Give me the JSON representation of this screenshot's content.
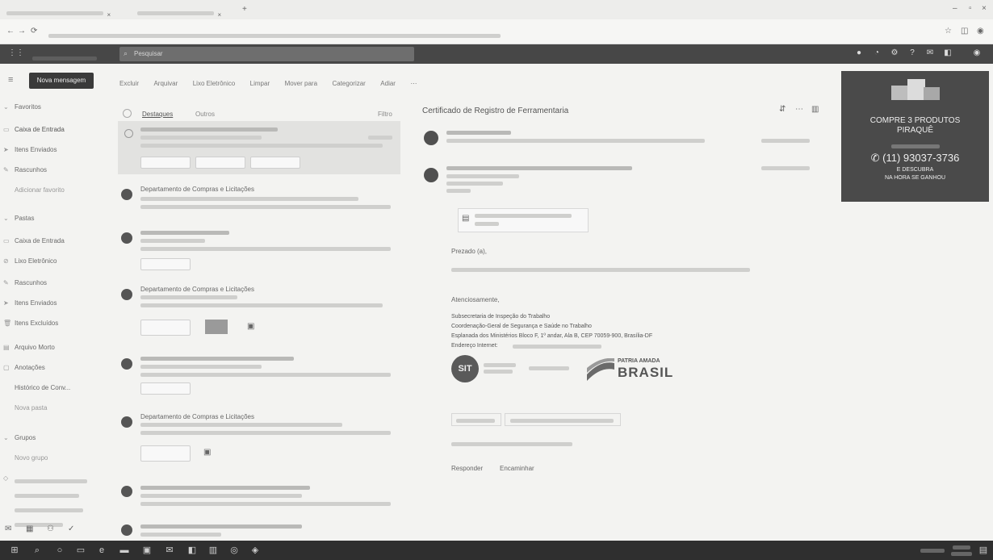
{
  "header": {
    "search_placeholder": "Pesquisar"
  },
  "toolbar": {
    "new_message": "Nova mensagem",
    "actions": [
      "Excluir",
      "Arquivar",
      "Lixo Eletrônico",
      "Limpar",
      "Mover para",
      "Categorizar",
      "Adiar"
    ]
  },
  "nav": {
    "favorites": "Favoritos",
    "fav_items": [
      "Caixa de Entrada",
      "Itens Enviados",
      "Rascunhos",
      "Adicionar favorito"
    ],
    "folders": "Pastas",
    "folder_items": [
      "Caixa de Entrada",
      "Lixo Eletrônico",
      "Rascunhos",
      "Itens Enviados",
      "Itens Excluídos",
      "Arquivo Morto",
      "Anotações",
      "Histórico de Conv...",
      "Nova pasta"
    ],
    "groups": "Grupos",
    "group_items": [
      "Novo grupo"
    ]
  },
  "list": {
    "tab_focused": "Destaques",
    "tab_other": "Outros",
    "filter": "Filtro",
    "senders": {
      "item2": "Departamento de Compras e Licitações",
      "item4": "Departamento de Compras e Licitações",
      "item6": "Departamento de Compras e Licitações"
    }
  },
  "reading": {
    "subject": "Certificado de Registro de Ferramentaria",
    "greeting": "Prezado (a),",
    "closing": "Atenciosamente,",
    "signature": [
      "Subsecretaria de Inspeção do Trabalho",
      "Coordenação-Geral de Segurança e Saúde no Trabalho",
      "Esplanada dos Ministérios Bloco F, 1º andar, Ala B, CEP 70059-900, Brasília-DF",
      "Endereço Internet:"
    ],
    "logos": {
      "sit": "SIT",
      "patria": "PATRIA AMADA",
      "brasil": "BRASIL"
    },
    "reply": "Responder",
    "forward": "Encaminhar"
  },
  "ad": {
    "line1": "COMPRE 3 PRODUTOS",
    "line2": "PIRAQUÊ",
    "phone": "(11) 93037-3736",
    "line3": "E DESCUBRA",
    "line4": "NA HORA SE GANHOU"
  },
  "colors": {
    "header_bar": "#474747",
    "ad_background": "#4a4a4a",
    "taskbar": "#2f2f2f"
  }
}
